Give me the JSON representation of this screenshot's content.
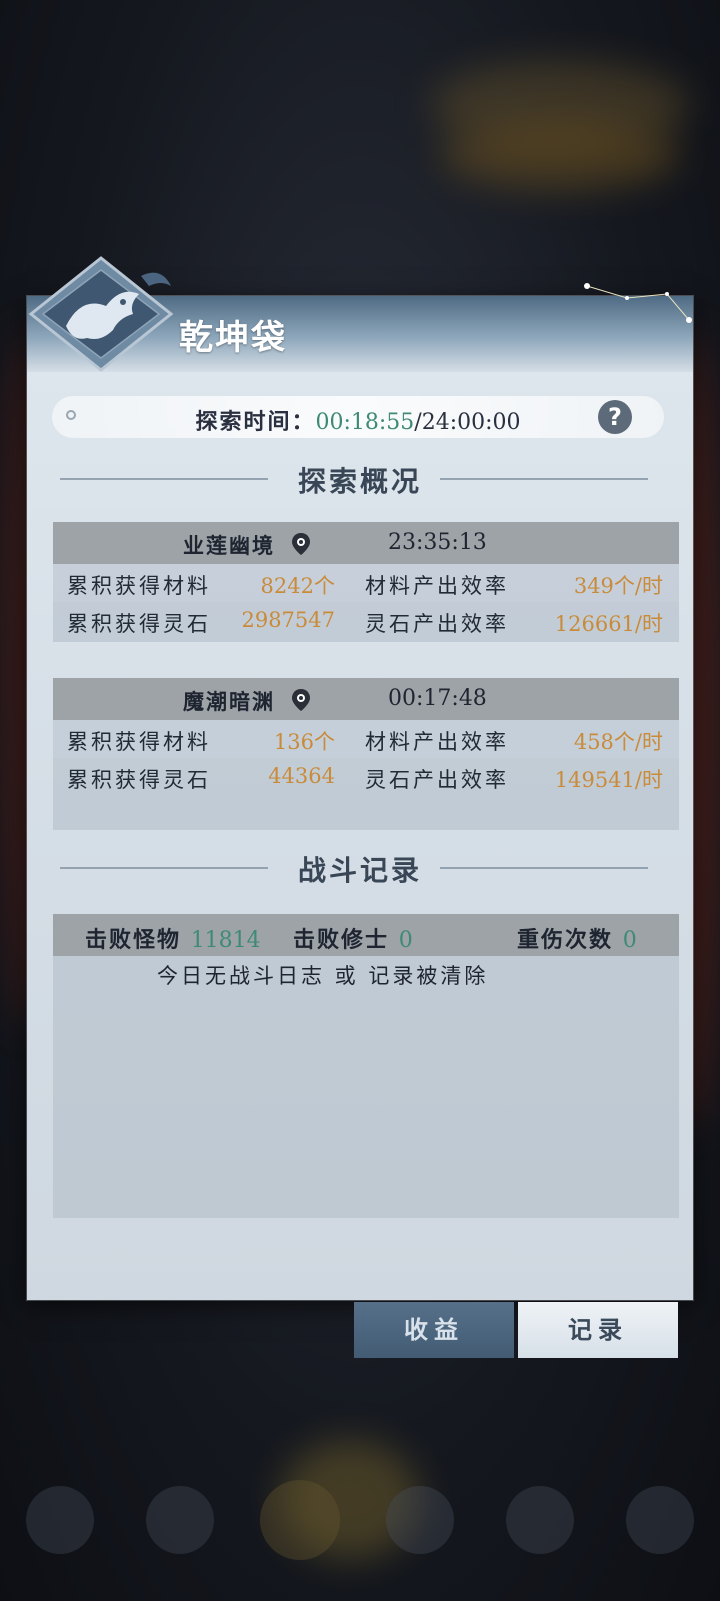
{
  "panel": {
    "title": "乾坤袋"
  },
  "explore_time": {
    "label": "探索时间：",
    "current": "00:18:55",
    "separator": "/",
    "total": "24:00:00"
  },
  "overview": {
    "title": "探索概况",
    "zones": [
      {
        "name": "业莲幽境",
        "timer": "23:35:13",
        "rows": [
          {
            "label": "累积获得材料",
            "value": "8242个",
            "rate_label": "材料产出效率",
            "rate": "349个/时"
          },
          {
            "label": "累积获得灵石",
            "value": "2987547",
            "rate_label": "灵石产出效率",
            "rate": "126661/时"
          }
        ]
      },
      {
        "name": "魔潮暗渊",
        "timer": "00:17:48",
        "rows": [
          {
            "label": "累积获得材料",
            "value": "136个",
            "rate_label": "材料产出效率",
            "rate": "458个/时"
          },
          {
            "label": "累积获得灵石",
            "value": "44364",
            "rate_label": "灵石产出效率",
            "rate": "149541/时"
          }
        ]
      }
    ]
  },
  "battle": {
    "title": "战斗记录",
    "monsters_label": "击败怪物",
    "monsters_value": "11814",
    "cultivators_label": "击败修士",
    "cultivators_value": "0",
    "injuries_label": "重伤次数",
    "injuries_value": "0",
    "message": "今日无战斗日志 或 记录被清除"
  },
  "tabs": {
    "income": "收益",
    "record": "记录"
  },
  "colors": {
    "value_orange": "#c98b3a",
    "value_green": "#3e8a74",
    "active_tab": "#435c74"
  }
}
